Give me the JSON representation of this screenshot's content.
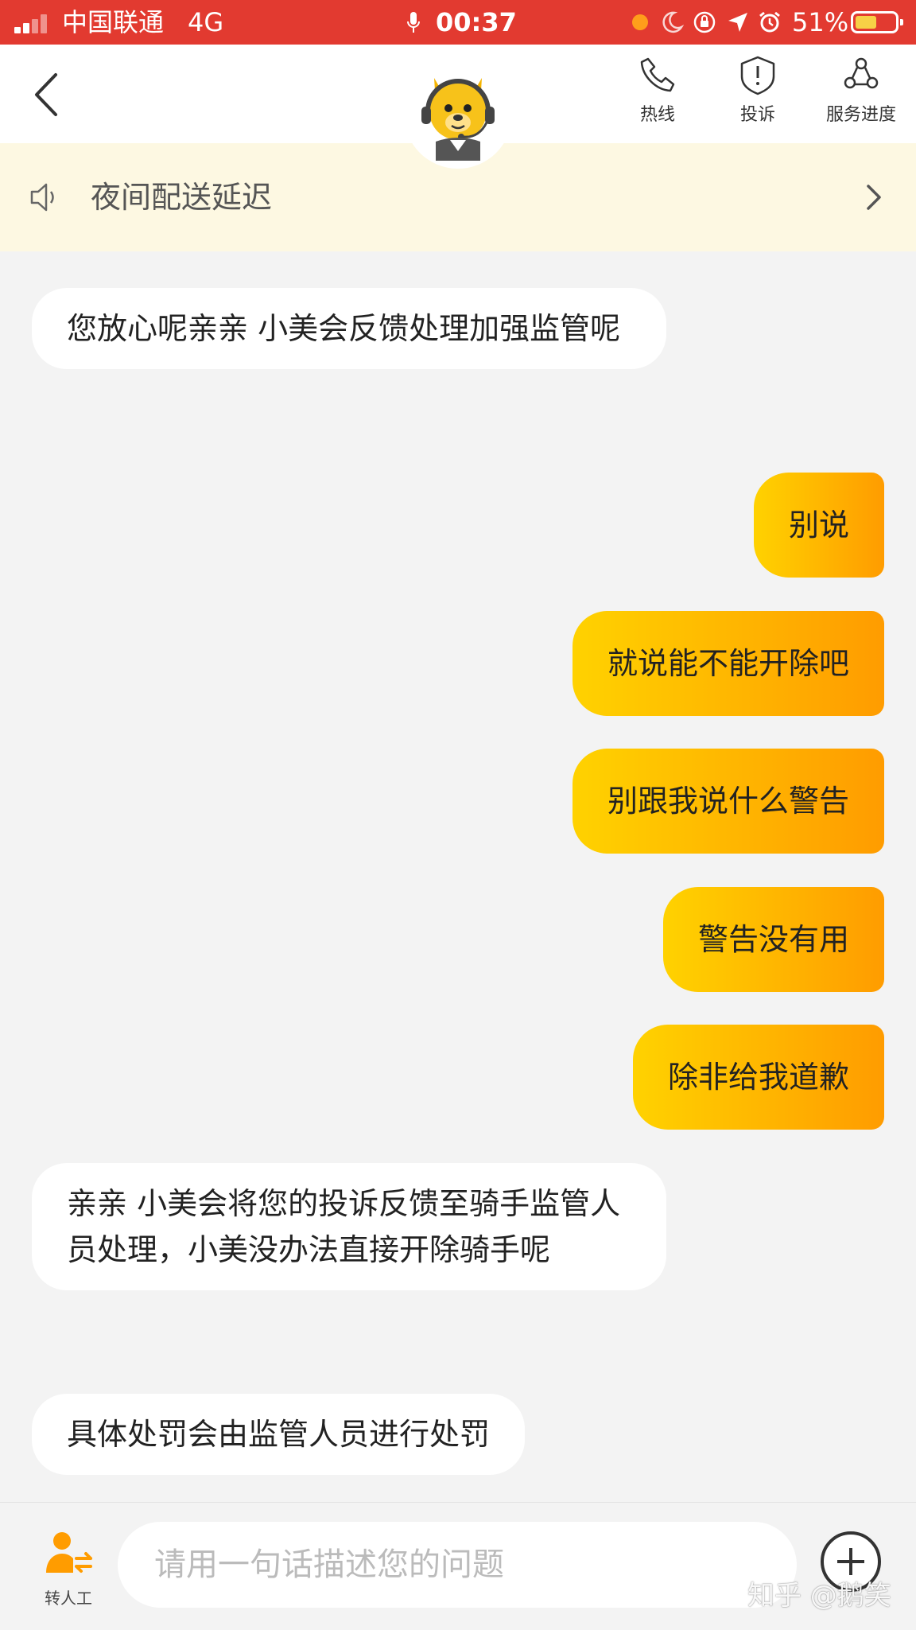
{
  "status_bar": {
    "carrier": "中国联通",
    "network": "4G",
    "time": "00:37",
    "battery_percent": "51%",
    "battery_level": 0.51,
    "background_color": "#e23a30"
  },
  "header": {
    "buttons": [
      {
        "label": "热线",
        "icon": "phone-icon"
      },
      {
        "label": "投诉",
        "icon": "shield-alert-icon"
      },
      {
        "label": "服务进度",
        "icon": "progress-icon"
      }
    ],
    "avatar_icon": "kangaroo-avatar"
  },
  "notice": {
    "text": "夜间配送延迟",
    "background_color": "#fdf8e2"
  },
  "messages": [
    {
      "from": "bot",
      "text": "您放心呢亲亲  小美会反馈处理加强监管呢"
    },
    {
      "from": "user",
      "text": "别说"
    },
    {
      "from": "user",
      "text": "就说能不能开除吧"
    },
    {
      "from": "user",
      "text": "别跟我说什么警告"
    },
    {
      "from": "user",
      "text": "警告没有用"
    },
    {
      "from": "user",
      "text": "除非给我道歉"
    },
    {
      "from": "bot",
      "text": "亲亲 小美会将您的投诉反馈至骑手监管人员处理，小美没办法直接开除骑手呢"
    },
    {
      "from": "bot",
      "text": "具体处罚会由监管人员进行处罚"
    }
  ],
  "input_bar": {
    "human_label": "转人工",
    "placeholder": "请用一句话描述您的问题",
    "value": ""
  },
  "watermark": "知乎 @鹅笑",
  "colors": {
    "accent_start": "#ffd200",
    "accent_end": "#ff9c00",
    "bot_bubble": "#ffffff",
    "chat_background": "#f3f3f3"
  }
}
